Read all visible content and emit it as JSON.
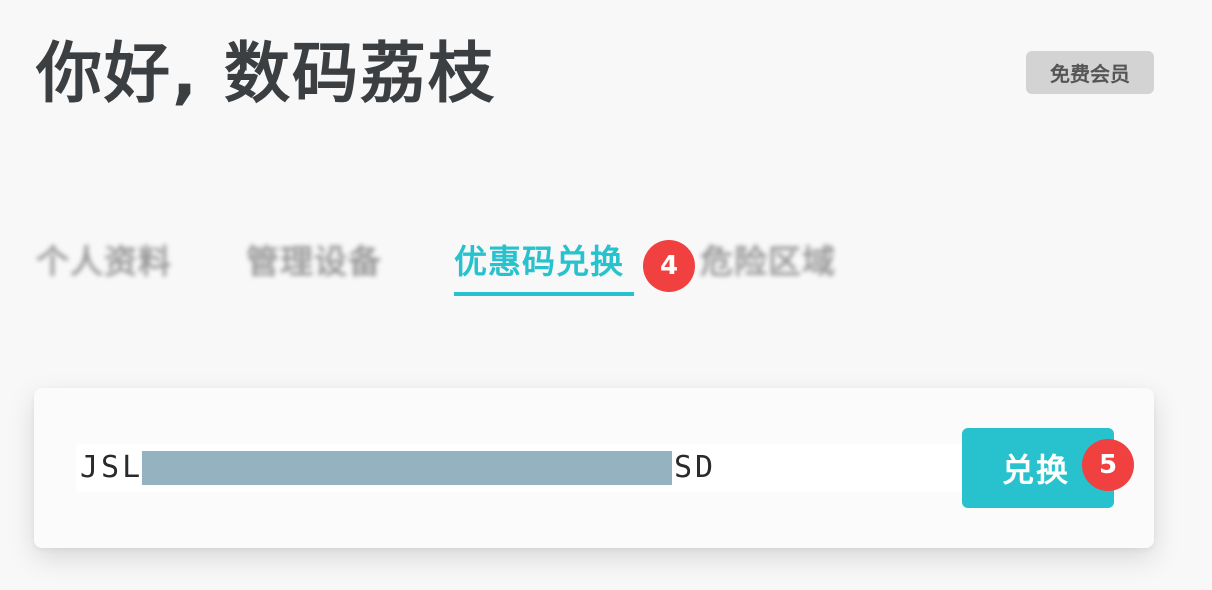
{
  "header": {
    "greeting": "你好, 数码荔枝",
    "membership_badge": "免费会员"
  },
  "tabs": [
    {
      "label": "个人资料",
      "active": false
    },
    {
      "label": "管理设备",
      "active": false
    },
    {
      "label": "优惠码兑换",
      "active": true
    },
    {
      "label": "危险区域",
      "active": false
    }
  ],
  "redeem": {
    "code_prefix": "JSL",
    "code_suffix": "SD",
    "button_label": "兑换"
  },
  "markers": {
    "tab_marker": "4",
    "button_marker": "5"
  },
  "colors": {
    "accent": "#27c2cd",
    "marker": "#f04040",
    "text_dark": "#3c3f42",
    "redaction": "#94b2c0"
  }
}
